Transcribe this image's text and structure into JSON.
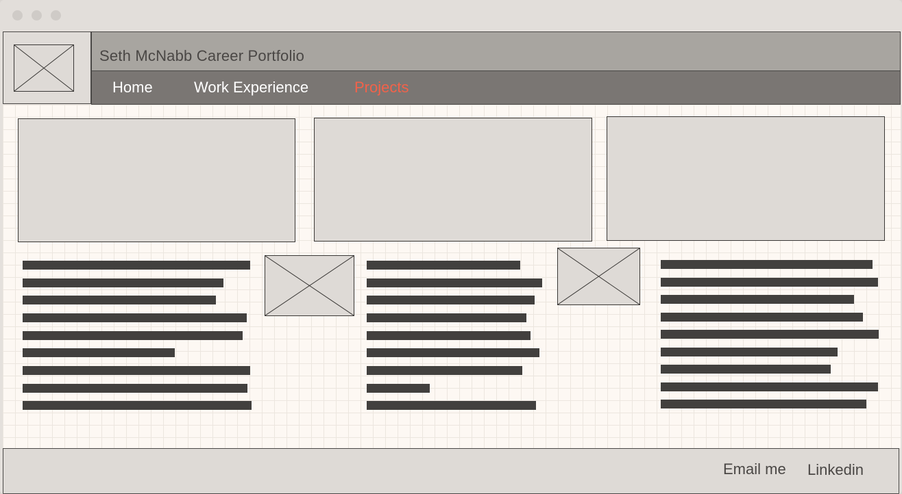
{
  "window": {
    "controls": [
      "close-dot",
      "minimize-dot",
      "zoom-dot"
    ]
  },
  "header": {
    "title": "Seth McNabb Career Portfolio",
    "logo_icon": "image-placeholder-icon"
  },
  "nav": {
    "items": [
      {
        "label": "Home",
        "active": false
      },
      {
        "label": "Work Experience",
        "active": false
      },
      {
        "label": "Projects",
        "active": true
      }
    ],
    "active_color": "#f2624a"
  },
  "main": {
    "project_cards": [
      {
        "image_icon": "image-placeholder-icon",
        "text_line_count": 9
      },
      {
        "image_icon": "image-placeholder-icon",
        "text_line_count": 9
      },
      {
        "image_icon": "image-placeholder-icon",
        "text_line_count": 9
      }
    ]
  },
  "footer": {
    "links": [
      "Email me",
      "Linkedin"
    ]
  }
}
